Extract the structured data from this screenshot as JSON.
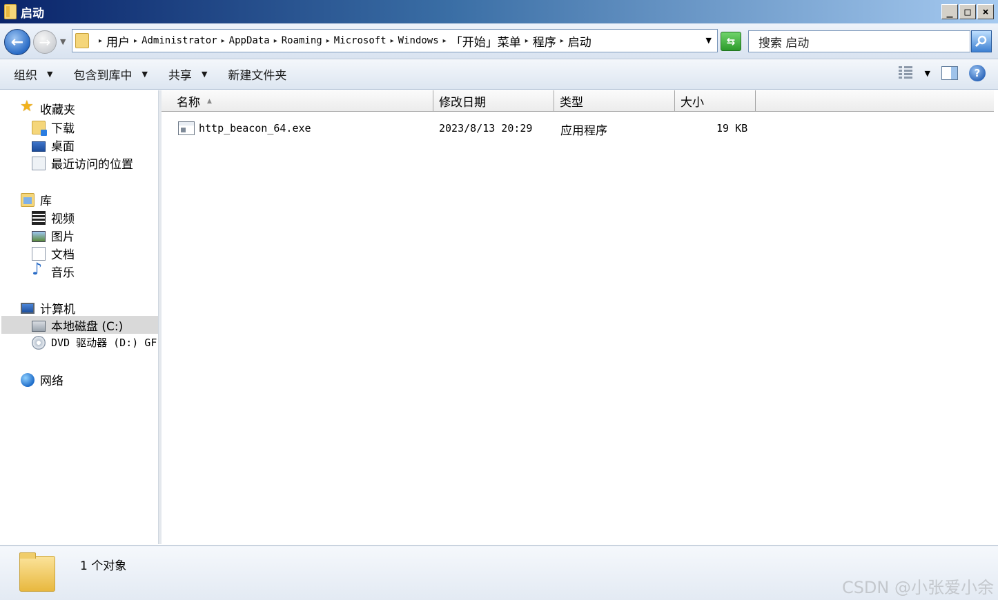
{
  "window": {
    "title": "启动",
    "buttons": {
      "minimize": "_",
      "maximize": "□",
      "close": "×"
    }
  },
  "address": {
    "breadcrumbs": [
      "用户",
      "Administrator",
      "AppData",
      "Roaming",
      "Microsoft",
      "Windows",
      "「开始」菜单",
      "程序",
      "启动"
    ],
    "search_placeholder": "搜索 启动"
  },
  "toolbar": {
    "organize": "组织",
    "include_in_library": "包含到库中",
    "share": "共享",
    "new_folder": "新建文件夹"
  },
  "nav": {
    "favorites": "收藏夹",
    "downloads": "下载",
    "desktop": "桌面",
    "recent": "最近访问的位置",
    "libraries": "库",
    "videos": "视频",
    "pictures": "图片",
    "documents": "文档",
    "music": "音乐",
    "computer": "计算机",
    "local_disk": "本地磁盘 (C:)",
    "dvd": "DVD 驱动器 (D:) GF",
    "network": "网络"
  },
  "columns": {
    "name": "名称",
    "date": "修改日期",
    "type": "类型",
    "size": "大小"
  },
  "files": [
    {
      "name": "http_beacon_64.exe",
      "date": "2023/8/13 20:29",
      "type": "应用程序",
      "size": "19 KB"
    }
  ],
  "status": {
    "count": "1 个对象"
  },
  "watermark": "CSDN @小张爱小余"
}
